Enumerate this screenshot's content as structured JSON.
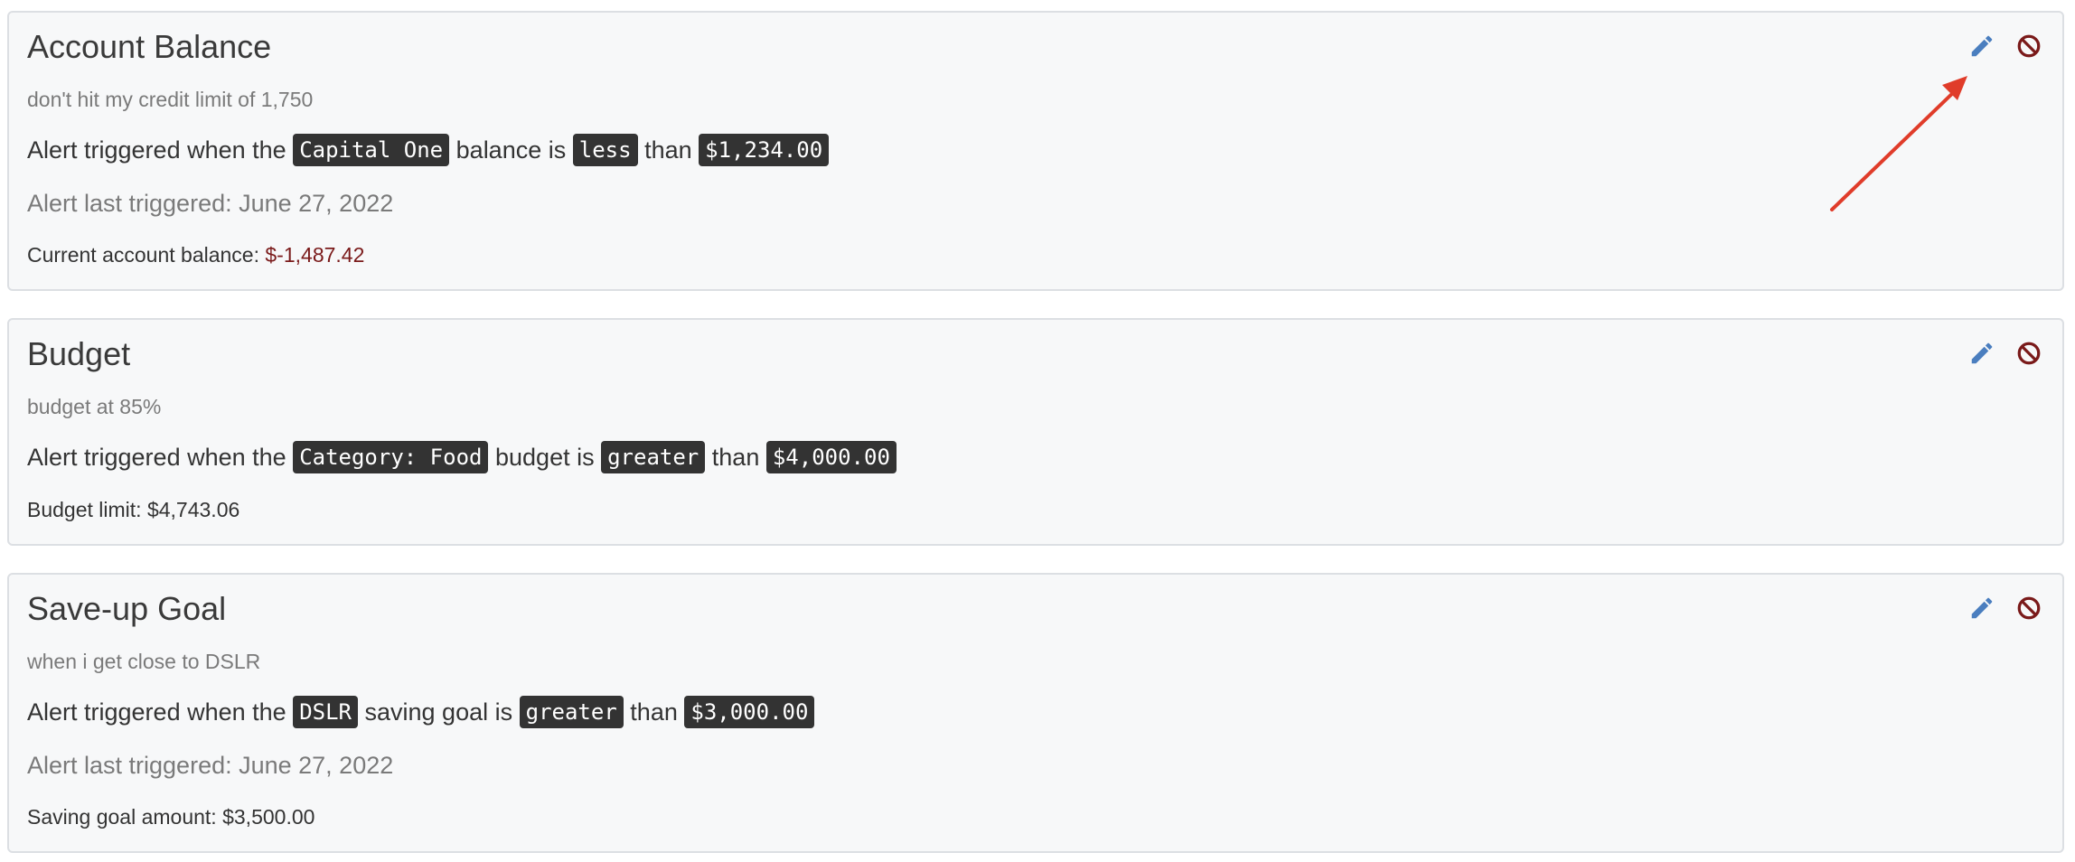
{
  "colors": {
    "edit_icon": "#4a7ebf",
    "delete_icon": "#7a1a1a",
    "negative_value": "#7a1a1a",
    "annotation_arrow": "#e03c2a",
    "code_background": "#333333"
  },
  "alerts": [
    {
      "title": "Account Balance",
      "description": "don't hit my credit limit of 1,750",
      "rule": {
        "prefix": "Alert triggered when the",
        "subject": "Capital One",
        "middle": "balance is",
        "comparator": "less",
        "joiner": "than",
        "amount": "$1,234.00"
      },
      "last_triggered": "Alert last triggered: June 27, 2022",
      "footer_label": "Current account balance:",
      "footer_value": "$-1,487.42"
    },
    {
      "title": "Budget",
      "description": "budget at 85%",
      "rule": {
        "prefix": "Alert triggered when the",
        "subject": "Category: Food",
        "middle": "budget is",
        "comparator": "greater",
        "joiner": "than",
        "amount": "$4,000.00"
      },
      "footer_label": "Budget limit:",
      "footer_value": "$4,743.06"
    },
    {
      "title": "Save-up Goal",
      "description": "when i get close to DSLR",
      "rule": {
        "prefix": "Alert triggered when the",
        "subject": "DSLR",
        "middle": "saving goal is",
        "comparator": "greater",
        "joiner": "than",
        "amount": "$3,000.00"
      },
      "last_triggered": "Alert last triggered: June 27, 2022",
      "footer_label": "Saving goal amount:",
      "footer_value": "$3,500.00"
    }
  ],
  "icons": {
    "edit": "pencil-icon",
    "delete": "ban-icon"
  }
}
